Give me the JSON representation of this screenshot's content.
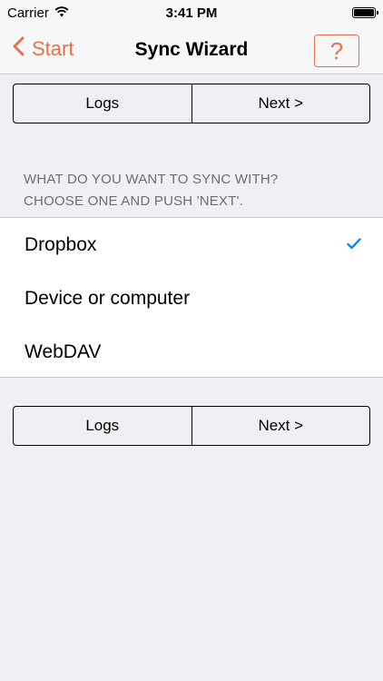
{
  "status_bar": {
    "carrier": "Carrier",
    "time": "3:41 PM",
    "wifi_icon": "wifi-icon",
    "battery_icon": "battery-icon"
  },
  "nav": {
    "back_label": "Start",
    "title": "Sync Wizard",
    "help_label": "?",
    "accent_color": "#e8704a"
  },
  "top_buttons": {
    "logs_label": "Logs",
    "next_label": "Next >"
  },
  "section": {
    "header_line1": "WHAT DO YOU WANT TO SYNC WITH?",
    "header_line2": "CHOOSE ONE AND PUSH 'NEXT'."
  },
  "options": [
    {
      "label": "Dropbox",
      "selected": true
    },
    {
      "label": "Device or computer",
      "selected": false
    },
    {
      "label": "WebDAV",
      "selected": false
    }
  ],
  "checkmark_color": "#007aff",
  "bottom_buttons": {
    "logs_label": "Logs",
    "next_label": "Next >"
  }
}
